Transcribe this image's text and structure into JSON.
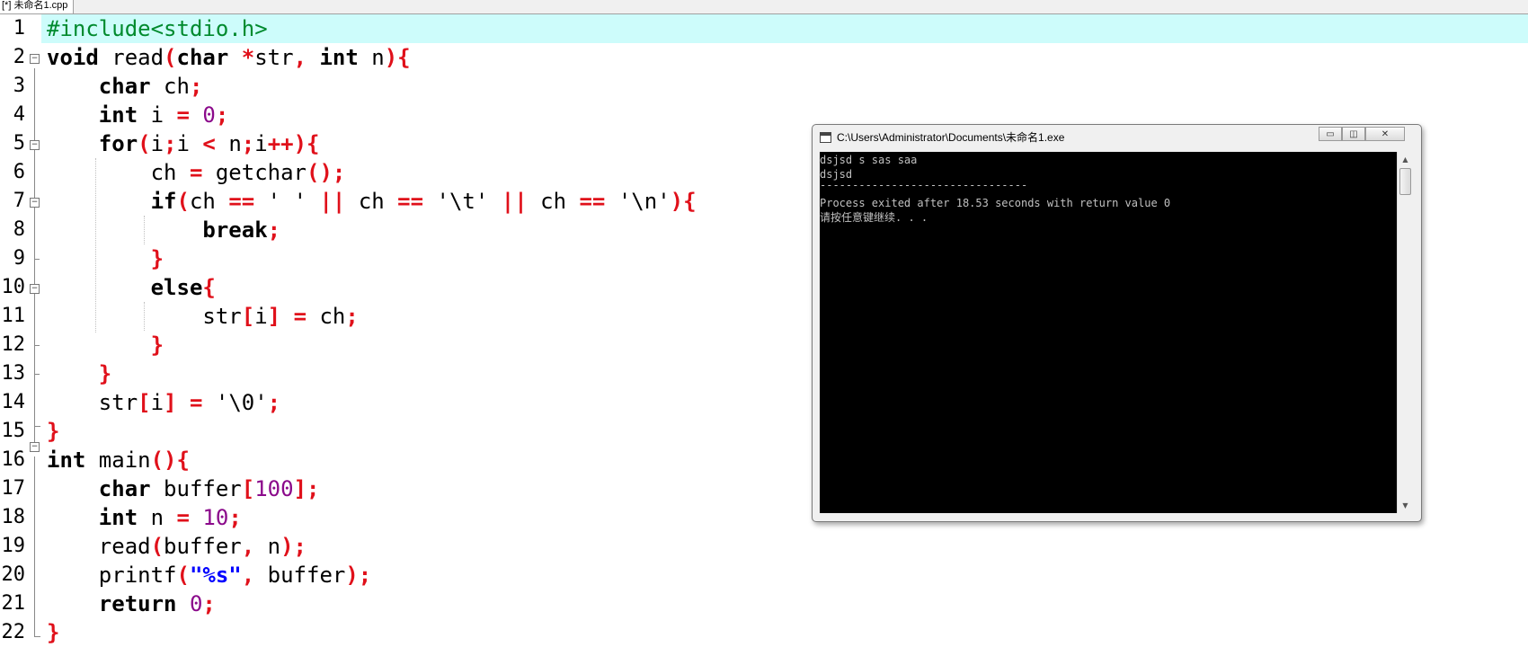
{
  "tab": {
    "label": "[*] 未命名1.cpp"
  },
  "editor": {
    "line_numbers": [
      "1",
      "2",
      "3",
      "4",
      "5",
      "6",
      "7",
      "8",
      "9",
      "10",
      "11",
      "12",
      "13",
      "14",
      "15",
      "16",
      "17",
      "18",
      "19",
      "20",
      "21",
      "22"
    ],
    "current_line": 1,
    "colors": {
      "current_line_bg": "#cdfcfb",
      "keyword": "#000000",
      "symbol": "#e0101a",
      "number": "#8b0a8b",
      "preprocessor": "#008a2e",
      "string": "#0000ff"
    },
    "lines": [
      [
        [
          "pp",
          "#include<stdio.h>"
        ]
      ],
      [
        [
          "kw",
          "void"
        ],
        [
          "",
          "&nbsp;read"
        ],
        [
          "sym",
          "("
        ],
        [
          "kw",
          "char"
        ],
        [
          "",
          "&nbsp;"
        ],
        [
          "sym",
          "*"
        ],
        [
          "",
          "str"
        ],
        [
          "sym",
          ","
        ],
        [
          "",
          "&nbsp;"
        ],
        [
          "kw",
          "int"
        ],
        [
          "",
          "&nbsp;n"
        ],
        [
          "sym",
          "){"
        ]
      ],
      [
        [
          "",
          "&nbsp;&nbsp;&nbsp;&nbsp;"
        ],
        [
          "kw",
          "char"
        ],
        [
          "",
          "&nbsp;ch"
        ],
        [
          "sym",
          ";"
        ]
      ],
      [
        [
          "",
          "&nbsp;&nbsp;&nbsp;&nbsp;"
        ],
        [
          "kw",
          "int"
        ],
        [
          "",
          "&nbsp;i&nbsp;"
        ],
        [
          "sym",
          "="
        ],
        [
          "",
          "&nbsp;"
        ],
        [
          "num",
          "0"
        ],
        [
          "sym",
          ";"
        ]
      ],
      [
        [
          "",
          "&nbsp;&nbsp;&nbsp;&nbsp;"
        ],
        [
          "kw",
          "for"
        ],
        [
          "sym",
          "("
        ],
        [
          "",
          "i"
        ],
        [
          "sym",
          ";"
        ],
        [
          "",
          "i&nbsp;"
        ],
        [
          "sym",
          "<"
        ],
        [
          "",
          "&nbsp;n"
        ],
        [
          "sym",
          ";"
        ],
        [
          "",
          "i"
        ],
        [
          "sym",
          "++){"
        ]
      ],
      [
        [
          "",
          "&nbsp;&nbsp;&nbsp;&nbsp;&nbsp;&nbsp;&nbsp;&nbsp;ch&nbsp;"
        ],
        [
          "sym",
          "="
        ],
        [
          "",
          "&nbsp;getchar"
        ],
        [
          "sym",
          "();"
        ]
      ],
      [
        [
          "",
          "&nbsp;&nbsp;&nbsp;&nbsp;&nbsp;&nbsp;&nbsp;&nbsp;"
        ],
        [
          "kw",
          "if"
        ],
        [
          "sym",
          "("
        ],
        [
          "",
          "ch&nbsp;"
        ],
        [
          "sym",
          "=="
        ],
        [
          "",
          "&nbsp;'&nbsp;'&nbsp;"
        ],
        [
          "sym",
          "||"
        ],
        [
          "",
          "&nbsp;ch&nbsp;"
        ],
        [
          "sym",
          "=="
        ],
        [
          "",
          "&nbsp;'\\t'&nbsp;"
        ],
        [
          "sym",
          "||"
        ],
        [
          "",
          "&nbsp;ch&nbsp;"
        ],
        [
          "sym",
          "=="
        ],
        [
          "",
          "&nbsp;'\\n'"
        ],
        [
          "sym",
          "){"
        ]
      ],
      [
        [
          "",
          "&nbsp;&nbsp;&nbsp;&nbsp;&nbsp;&nbsp;&nbsp;&nbsp;&nbsp;&nbsp;&nbsp;&nbsp;"
        ],
        [
          "kw",
          "break"
        ],
        [
          "sym",
          ";"
        ]
      ],
      [
        [
          "",
          "&nbsp;&nbsp;&nbsp;&nbsp;&nbsp;&nbsp;&nbsp;&nbsp;"
        ],
        [
          "sym",
          "}"
        ]
      ],
      [
        [
          "",
          "&nbsp;&nbsp;&nbsp;&nbsp;&nbsp;&nbsp;&nbsp;&nbsp;"
        ],
        [
          "kw",
          "else"
        ],
        [
          "sym",
          "{"
        ]
      ],
      [
        [
          "",
          "&nbsp;&nbsp;&nbsp;&nbsp;&nbsp;&nbsp;&nbsp;&nbsp;&nbsp;&nbsp;&nbsp;&nbsp;str"
        ],
        [
          "sym",
          "["
        ],
        [
          "",
          "i"
        ],
        [
          "sym",
          "]"
        ],
        [
          "",
          "&nbsp;"
        ],
        [
          "sym",
          "="
        ],
        [
          "",
          "&nbsp;ch"
        ],
        [
          "sym",
          ";"
        ]
      ],
      [
        [
          "",
          "&nbsp;&nbsp;&nbsp;&nbsp;&nbsp;&nbsp;&nbsp;&nbsp;"
        ],
        [
          "sym",
          "}"
        ]
      ],
      [
        [
          "",
          "&nbsp;&nbsp;&nbsp;&nbsp;"
        ],
        [
          "sym",
          "}"
        ]
      ],
      [
        [
          "",
          "&nbsp;&nbsp;&nbsp;&nbsp;str"
        ],
        [
          "sym",
          "["
        ],
        [
          "",
          "i"
        ],
        [
          "sym",
          "]"
        ],
        [
          "",
          "&nbsp;"
        ],
        [
          "sym",
          "="
        ],
        [
          "",
          "&nbsp;'\\0'"
        ],
        [
          "sym",
          ";"
        ]
      ],
      [
        [
          "sym",
          "}"
        ]
      ],
      [
        [
          "kw",
          "int"
        ],
        [
          "",
          "&nbsp;main"
        ],
        [
          "sym",
          "(){"
        ]
      ],
      [
        [
          "",
          "&nbsp;&nbsp;&nbsp;&nbsp;"
        ],
        [
          "kw",
          "char"
        ],
        [
          "",
          "&nbsp;buffer"
        ],
        [
          "sym",
          "["
        ],
        [
          "num",
          "100"
        ],
        [
          "sym",
          "];"
        ]
      ],
      [
        [
          "",
          "&nbsp;&nbsp;&nbsp;&nbsp;"
        ],
        [
          "kw",
          "int"
        ],
        [
          "",
          "&nbsp;n&nbsp;"
        ],
        [
          "sym",
          "="
        ],
        [
          "",
          "&nbsp;"
        ],
        [
          "num",
          "10"
        ],
        [
          "sym",
          ";"
        ]
      ],
      [
        [
          "",
          "&nbsp;&nbsp;&nbsp;&nbsp;read"
        ],
        [
          "sym",
          "("
        ],
        [
          "",
          "buffer"
        ],
        [
          "sym",
          ","
        ],
        [
          "",
          "&nbsp;n"
        ],
        [
          "sym",
          ");"
        ]
      ],
      [
        [
          "",
          "&nbsp;&nbsp;&nbsp;&nbsp;printf"
        ],
        [
          "sym",
          "("
        ],
        [
          "str",
          "\"%s\""
        ],
        [
          "sym",
          ","
        ],
        [
          "",
          "&nbsp;buffer"
        ],
        [
          "sym",
          ");"
        ]
      ],
      [
        [
          "",
          "&nbsp;&nbsp;&nbsp;&nbsp;"
        ],
        [
          "kw",
          "return"
        ],
        [
          "",
          "&nbsp;"
        ],
        [
          "num",
          "0"
        ],
        [
          "sym",
          ";"
        ]
      ],
      [
        [
          "sym",
          "}"
        ]
      ]
    ]
  },
  "console": {
    "title": "C:\\Users\\Administrator\\Documents\\未命名1.exe",
    "buttons": {
      "minimize": "▭",
      "restore": "◫",
      "close": "✕"
    },
    "output": [
      "dsjsd s sas saa",
      "dsjsd",
      "--------------------------------",
      "Process exited after 18.53 seconds with return value 0",
      "请按任意键继续. . ."
    ],
    "scroll_up": "▲",
    "scroll_down": "▼"
  }
}
